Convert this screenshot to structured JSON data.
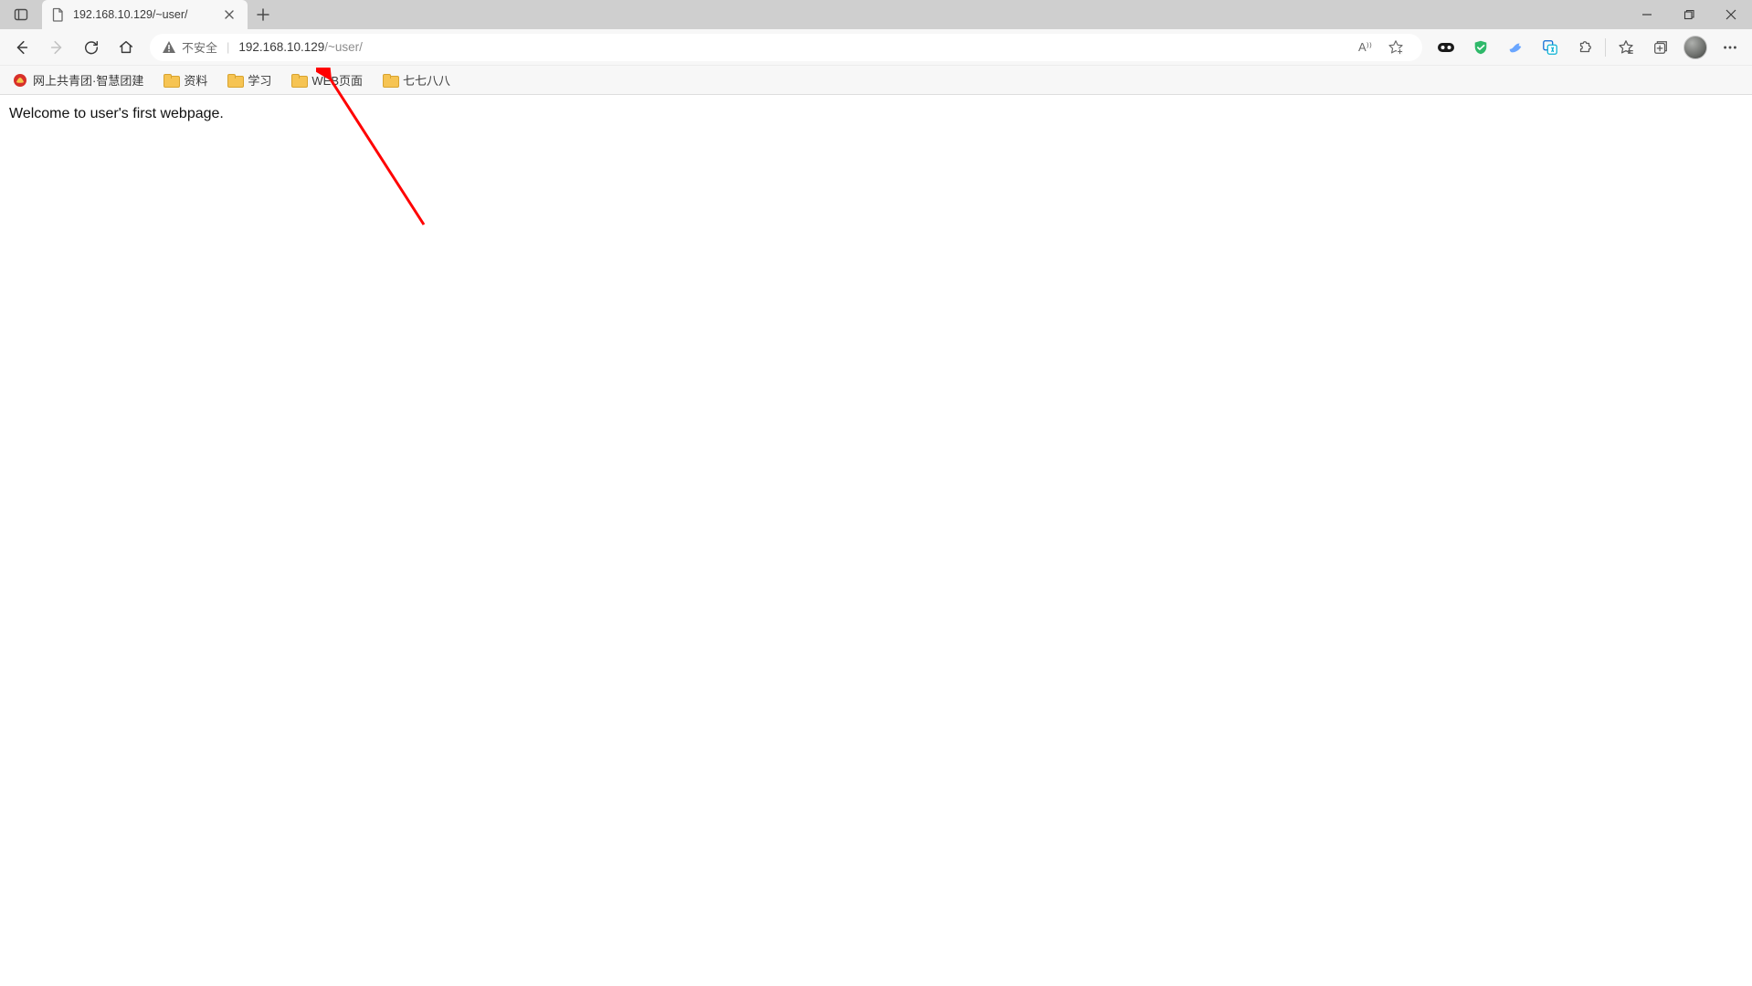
{
  "window": {
    "tab_title": "192.168.10.129/~user/",
    "security_label": "不安全",
    "url_host": "192.168.10.129",
    "url_path": "/~user/",
    "read_aloud_label": "A⁾⁾"
  },
  "bookmarks": [
    {
      "label": "网上共青团·智慧团建",
      "icon": "red"
    },
    {
      "label": "资料",
      "icon": "folder"
    },
    {
      "label": "学习",
      "icon": "folder"
    },
    {
      "label": "WEB页面",
      "icon": "folder"
    },
    {
      "label": "七七八八",
      "icon": "folder"
    }
  ],
  "page": {
    "body_text": "Welcome to user's first webpage."
  },
  "colors": {
    "titlebar": "#cfcfcf",
    "chrome": "#f7f7f7",
    "accent_arrow": "#ff0000"
  }
}
